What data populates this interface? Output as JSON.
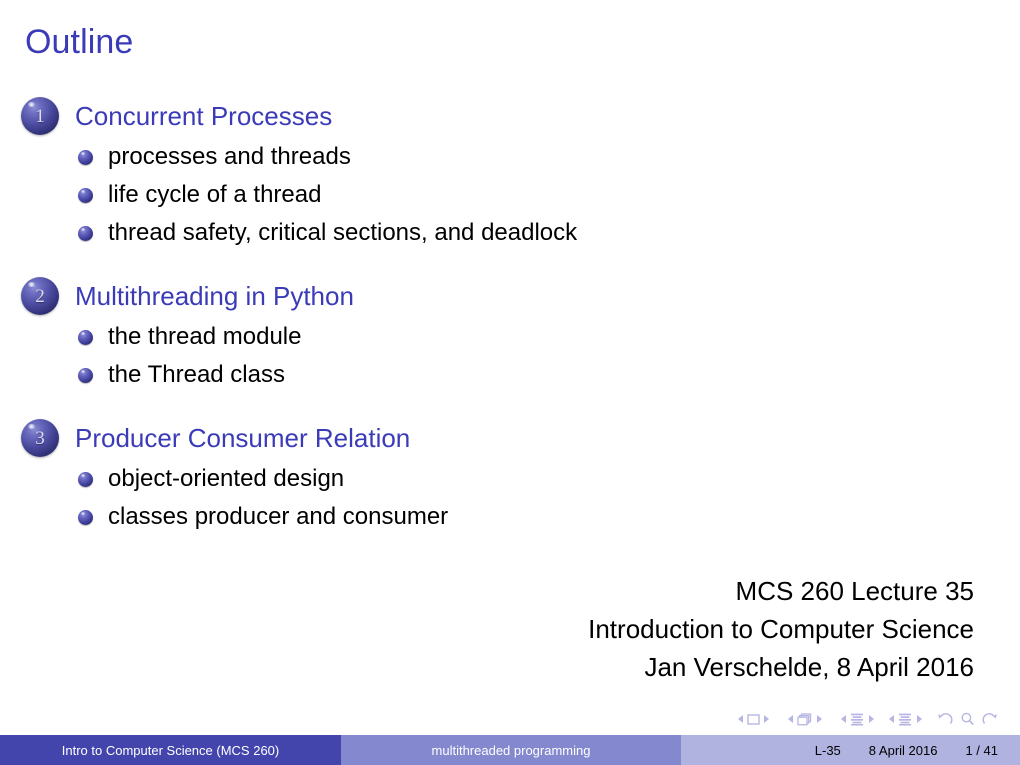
{
  "slide": {
    "frame_title": "Outline",
    "sections": [
      {
        "number": "1",
        "title": "Concurrent Processes",
        "items": [
          "processes and threads",
          "life cycle of a thread",
          "thread safety, critical sections, and deadlock"
        ]
      },
      {
        "number": "2",
        "title": "Multithreading in Python",
        "items": [
          "the thread module",
          "the Thread class"
        ]
      },
      {
        "number": "3",
        "title": "Producer Consumer Relation",
        "items": [
          "object-oriented design",
          "classes producer and consumer"
        ]
      }
    ],
    "author_block": [
      "MCS 260 Lecture 35",
      "Introduction to Computer Science",
      "Jan Verschelde, 8 April 2016"
    ]
  },
  "navigation": {
    "icons": [
      "slide-icon",
      "frames-icon",
      "subsections-icon",
      "sections-icon",
      "back-icon",
      "search-icon",
      "forward-icon"
    ]
  },
  "footer": {
    "left": "Intro to Computer Science  (MCS 260)",
    "middle": "multithreaded programming",
    "right_lecture": "L-35",
    "right_date": "8 April 2016",
    "right_page": "1 / 41"
  },
  "colors": {
    "title_blue": "#3b3bb8",
    "footer_dark": "#4345ad",
    "footer_mid": "#8388cf",
    "footer_light": "#b0b2e0",
    "nav_symbol": "#b6b6e4",
    "body_text": "#000000"
  }
}
